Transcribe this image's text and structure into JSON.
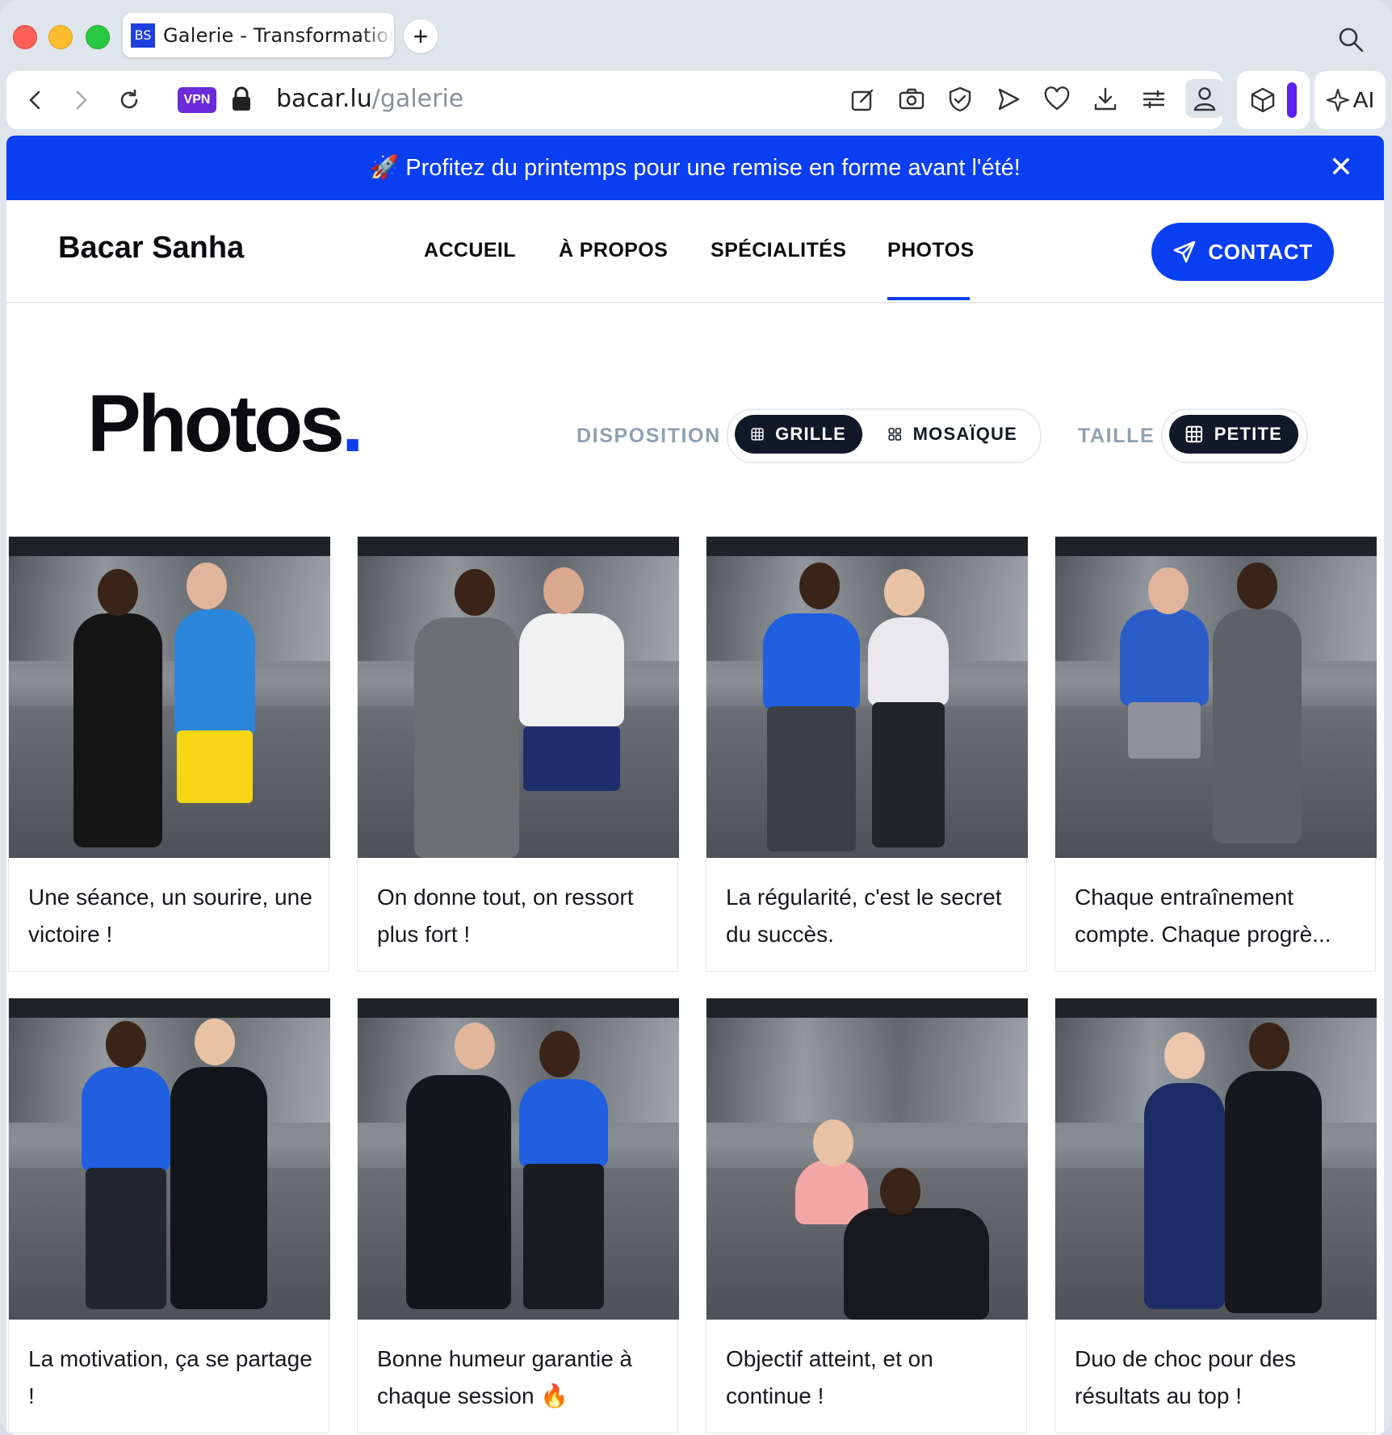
{
  "browser": {
    "tab_title": "Galerie - Transformation",
    "favicon_text": "BS",
    "new_tab_label": "+",
    "vpn_label": "VPN",
    "url_domain": "bacar.lu",
    "url_path": "/galerie",
    "ai_label": "AI",
    "accent": "#6c2bd9"
  },
  "banner": {
    "emoji": "🚀",
    "text": "Profitez du printemps pour une remise en forme avant l'été!",
    "close_label": "✕",
    "color": "#0a3ef1"
  },
  "nav": {
    "brand": "Bacar Sanha",
    "links": [
      "ACCUEIL",
      "À PROPOS",
      "SPÉCIALITÉS",
      "PHOTOS"
    ],
    "active_link": "PHOTOS",
    "contact_label": "CONTACT"
  },
  "gallery": {
    "title": "Photos",
    "title_dot": ".",
    "layout_label": "DISPOSITION",
    "layout_options": [
      "GRILLE",
      "MOSAÏQUE"
    ],
    "layout_selected": "GRILLE",
    "size_label": "TAILLE",
    "size_selected": "PETITE",
    "items": [
      {
        "caption": "Une séance, un sourire, une victoire !"
      },
      {
        "caption": "On donne tout, on ressort plus fort !"
      },
      {
        "caption": "La régularité, c'est le secret du succès."
      },
      {
        "caption": "Chaque entraînement compte. Chaque progrè..."
      },
      {
        "caption": "La motivation, ça se partage !"
      },
      {
        "caption": "Bonne humeur garantie à chaque session 🔥"
      },
      {
        "caption": "Objectif atteint, et on continue !"
      },
      {
        "caption": "Duo de choc pour des résultats au top !"
      }
    ]
  }
}
